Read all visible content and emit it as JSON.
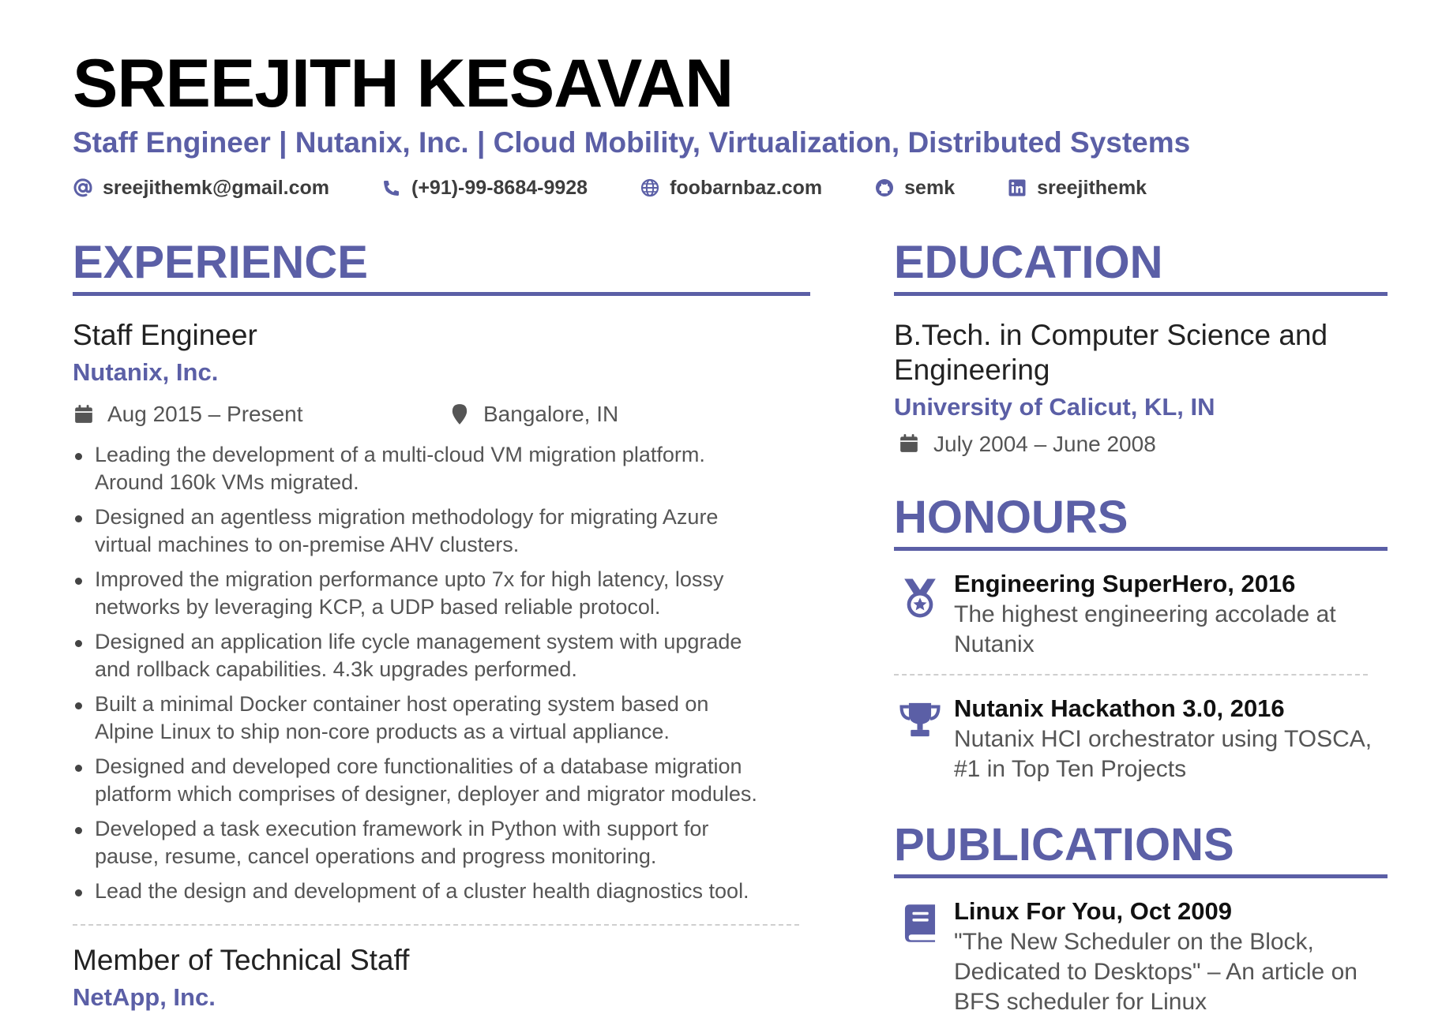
{
  "header": {
    "name": "SREEJITH KESAVAN",
    "tagline": "Staff Engineer | Nutanix, Inc. | Cloud Mobility, Virtualization, Distributed Systems",
    "contacts": [
      {
        "icon": "at-icon",
        "text": "sreejithemk@gmail.com"
      },
      {
        "icon": "phone-icon",
        "text": "(+91)-99-8684-9928"
      },
      {
        "icon": "globe-icon",
        "text": "foobarnbaz.com"
      },
      {
        "icon": "github-icon",
        "text": "semk"
      },
      {
        "icon": "linkedin-icon",
        "text": "sreejithemk"
      }
    ]
  },
  "experience": {
    "title": "EXPERIENCE",
    "jobs": [
      {
        "title": "Staff Engineer",
        "company": "Nutanix, Inc.",
        "dates": "Aug 2015 – Present",
        "location": "Bangalore, IN",
        "bullets": [
          "Leading the development of a multi-cloud VM migration platform. Around 160k VMs migrated.",
          "Designed an agentless migration methodology for migrating Azure virtual machines to on-premise AHV clusters.",
          "Improved the migration performance upto 7x for high latency, lossy networks by leveraging KCP, a UDP based reliable protocol.",
          "Designed an application life cycle management system with upgrade and rollback capabilities. 4.3k upgrades performed.",
          "Built a minimal Docker container host operating system based on Alpine Linux to ship non-core products as a virtual appliance.",
          "Designed and developed core functionalities of a database migration platform which comprises of designer, deployer and migrator modules.",
          "Developed a task execution framework in Python with support for pause, resume, cancel operations and progress monitoring.",
          "Lead the design and development of a cluster health diagnostics tool."
        ]
      },
      {
        "title": "Member of Technical Staff",
        "company": "NetApp, Inc."
      }
    ]
  },
  "education": {
    "title": "EDUCATION",
    "degree": "B.Tech. in Computer Science and Engineering",
    "school": "University of Calicut, KL, IN",
    "dates": "July 2004 – June 2008"
  },
  "honours": {
    "title": "HONOURS",
    "items": [
      {
        "icon": "medal-icon",
        "title": "Engineering SuperHero, 2016",
        "desc": "The highest engineering accolade at Nutanix"
      },
      {
        "icon": "trophy-icon",
        "title": "Nutanix Hackathon 3.0, 2016",
        "desc": "Nutanix HCI orchestrator using TOSCA, #1 in Top Ten Projects"
      }
    ]
  },
  "publications": {
    "title": "PUBLICATIONS",
    "items": [
      {
        "icon": "book-icon",
        "title": "Linux For You, Oct 2009",
        "desc": "\"The New Scheduler on the Block, Dedicated to Desktops\" – An article on BFS scheduler for Linux"
      }
    ]
  },
  "colors": {
    "accent": "#5b5fa6",
    "text": "#3d3d3d",
    "muted": "#555555"
  }
}
